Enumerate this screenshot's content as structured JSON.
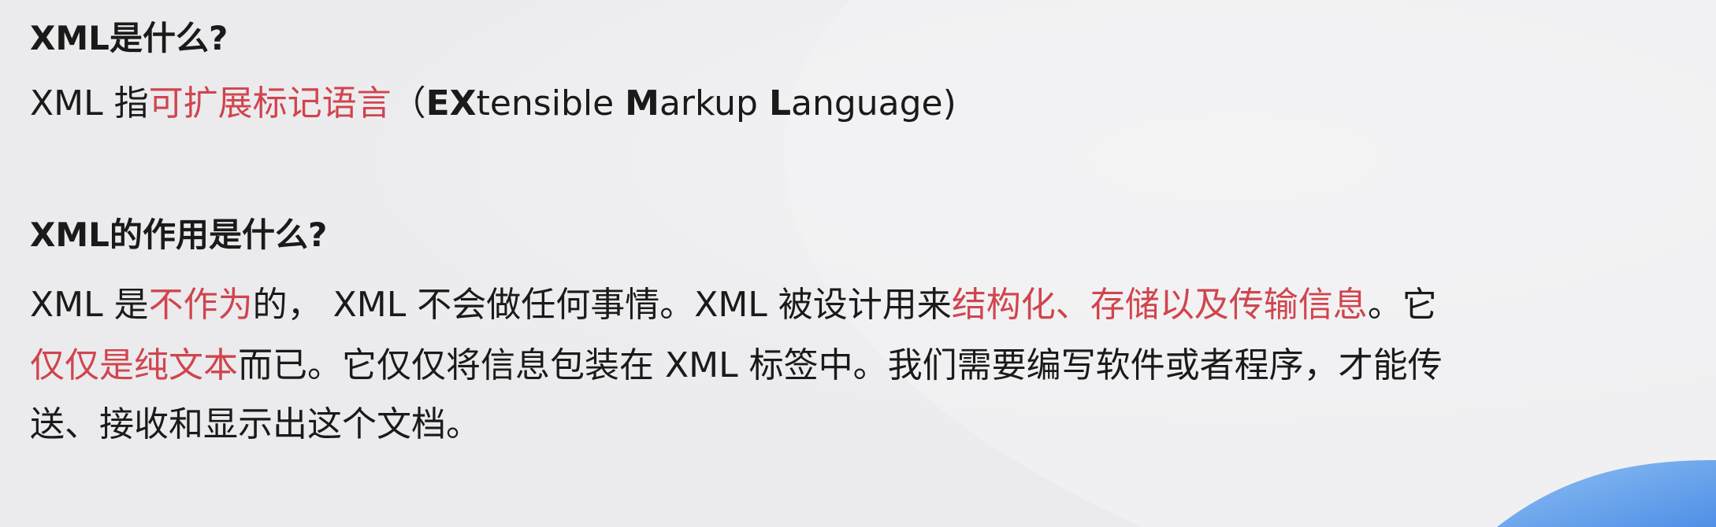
{
  "section1": {
    "title": "XML是什么?",
    "line": {
      "prefix": "XML 指",
      "highlight": "可扩展标记语言",
      "open_paren": "（",
      "e_bold": "EX",
      "e_rest": "tensible ",
      "m_bold": "M",
      "m_rest": "arkup ",
      "l_bold": "L",
      "l_rest": "anguage)"
    }
  },
  "section2": {
    "title": "XML的作用是什么?",
    "p1": {
      "a": "XML 是",
      "b": "不作为",
      "c": "的， XML 不会做任何事情。XML 被设计用来",
      "d": "结构化、存储以及传输信息",
      "e": "。它"
    },
    "p2": {
      "a": "仅仅是纯文本",
      "b": "而已。它仅仅将信息包装在 XML 标签中。我们需要编写软件或者程序，才能传"
    },
    "p3": {
      "a": "送、接收和显示出这个文档。"
    }
  },
  "colors": {
    "highlight": "#d0454e",
    "background": "#eeeef1",
    "accent_blue": "#5b9be8"
  }
}
